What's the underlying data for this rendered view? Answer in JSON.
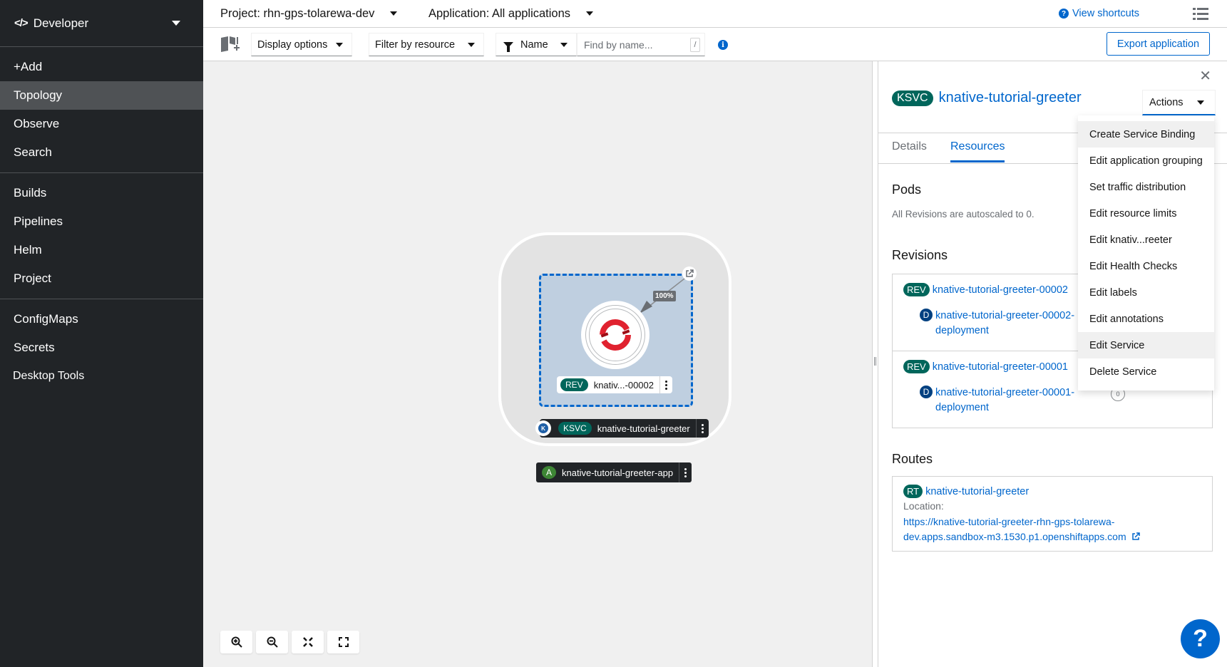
{
  "sidebar": {
    "perspective": "Developer",
    "nav_groups": [
      [
        {
          "label": "+Add",
          "active": false
        },
        {
          "label": "Topology",
          "active": true
        },
        {
          "label": "Observe",
          "active": false
        },
        {
          "label": "Search",
          "active": false
        }
      ],
      [
        {
          "label": "Builds"
        },
        {
          "label": "Pipelines"
        },
        {
          "label": "Helm"
        },
        {
          "label": "Project"
        }
      ],
      [
        {
          "label": "ConfigMaps"
        },
        {
          "label": "Secrets"
        }
      ]
    ],
    "extra_item": "Desktop Tools"
  },
  "topbar": {
    "project": "Project: rhn-gps-tolarewa-dev",
    "application": "Application: All applications",
    "shortcuts": "View shortcuts"
  },
  "toolbar": {
    "display_options": "Display options",
    "filter_by_resource": "Filter by resource",
    "name_filter": "Name",
    "search_placeholder": "Find by name...",
    "search_shortcut": "/",
    "export_label": "Export application"
  },
  "topology": {
    "traffic_percent": "100%",
    "revision_badge": "REV",
    "revision_label": "knativ...-00002",
    "service_badge": "KSVC",
    "service_label": "knative-tutorial-greeter",
    "app_badge": "A",
    "app_label": "knative-tutorial-greeter-app"
  },
  "panel": {
    "badge": "KSVC",
    "title": "knative-tutorial-greeter",
    "actions_label": "Actions",
    "tabs": [
      {
        "label": "Details",
        "active": false
      },
      {
        "label": "Resources",
        "active": true
      }
    ],
    "pods_heading": "Pods",
    "pods_text": "All Revisions are autoscaled to 0.",
    "revisions_heading": "Revisions",
    "revisions": [
      {
        "badge": "REV",
        "name": "knative-tutorial-greeter-00002",
        "dep_badge": "D",
        "deployment_line1": "knative-tutorial-greeter-00002-",
        "deployment_line2": "deployment"
      },
      {
        "badge": "REV",
        "name": "knative-tutorial-greeter-00001",
        "dep_badge": "D",
        "deployment_line1": "knative-tutorial-greeter-00001-",
        "deployment_line2": "deployment",
        "pod_count": "0"
      }
    ],
    "routes_heading": "Routes",
    "route": {
      "badge": "RT",
      "name": "knative-tutorial-greeter",
      "location_label": "Location:",
      "url_line1": "https://knative-tutorial-greeter-rhn-gps-tolarewa-",
      "url_line2": "dev.apps.sandbox-m3.1530.p1.openshiftapps.com"
    }
  },
  "actions_menu": {
    "items": [
      {
        "label": "Create Service Binding",
        "highlighted": true
      },
      {
        "label": "Edit application grouping",
        "highlighted": false
      },
      {
        "label": "Set traffic distribution",
        "highlighted": false
      },
      {
        "label": "Edit resource limits",
        "highlighted": false
      },
      {
        "label": "Edit knativ...reeter",
        "highlighted": false
      },
      {
        "label": "Edit Health Checks",
        "highlighted": false
      },
      {
        "label": "Edit labels",
        "highlighted": false
      },
      {
        "label": "Edit annotations",
        "highlighted": false
      },
      {
        "label": "Edit Service",
        "highlighted": true
      },
      {
        "label": "Delete Service",
        "highlighted": false
      }
    ]
  },
  "help_fab": "?",
  "colors": {
    "accent": "#0066cc",
    "ksvc_badge": "#00665b",
    "sidebar_bg": "#212427"
  }
}
